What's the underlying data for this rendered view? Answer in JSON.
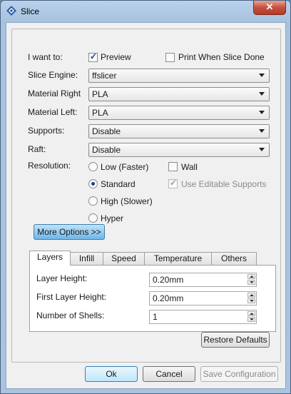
{
  "window": {
    "title": "Slice",
    "close_glyph": "✕"
  },
  "form": {
    "i_want_to_label": "I want to:",
    "preview_label": "Preview",
    "preview_checked": true,
    "print_when_done_label": "Print When Slice Done",
    "print_when_done_checked": false,
    "slice_engine_label": "Slice Engine:",
    "slice_engine_value": "ffslicer",
    "material_right_label": "Material Right",
    "material_right_value": "PLA",
    "material_left_label": "Material Left:",
    "material_left_value": "PLA",
    "supports_label": "Supports:",
    "supports_value": "Disable",
    "raft_label": "Raft:",
    "raft_value": "Disable",
    "resolution_label": "Resolution:",
    "resolutions": [
      {
        "label": "Low (Faster)",
        "selected": false
      },
      {
        "label": "Standard",
        "selected": true
      },
      {
        "label": "High (Slower)",
        "selected": false
      },
      {
        "label": "Hyper",
        "selected": false
      }
    ],
    "wall_label": "Wall",
    "wall_checked": false,
    "editable_supports_label": "Use Editable Supports",
    "editable_supports_checked": true,
    "more_options_label": "More Options >>"
  },
  "tabs": [
    "Layers",
    "Infill",
    "Speed",
    "Temperature",
    "Others"
  ],
  "active_tab": "Layers",
  "layers": {
    "layer_height_label": "Layer Height:",
    "layer_height_value": "0.20mm",
    "first_layer_height_label": "First Layer Height:",
    "first_layer_height_value": "0.20mm",
    "shells_label": "Number of Shells:",
    "shells_value": "1"
  },
  "buttons": {
    "restore_defaults": "Restore Defaults",
    "ok": "Ok",
    "cancel": "Cancel",
    "save_configuration": "Save Configuration"
  },
  "icons": {
    "app": "slice-app-icon",
    "close": "close-icon",
    "dropdown": "chevron-down-icon",
    "spin_up": "spin-up-icon",
    "spin_down": "spin-down-icon"
  }
}
